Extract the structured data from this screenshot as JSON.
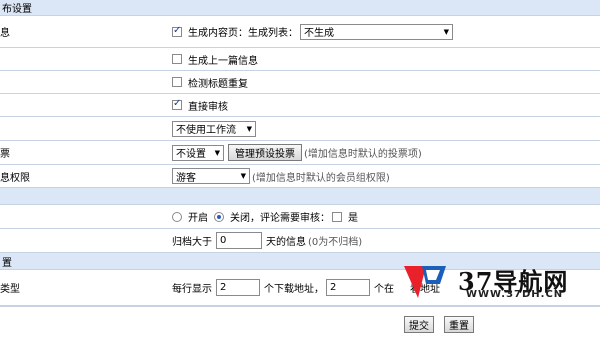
{
  "top": {
    "partial_text": "..."
  },
  "sections": {
    "publish": "布设置",
    "reply": "置"
  },
  "rows": {
    "r1_label": "息",
    "r1_checkbox": "生成内容页：",
    "r1_list_label": "生成列表：",
    "r1_list_value": "不生成",
    "r2_checkbox": "生成上一篇信息",
    "r3_checkbox": "检测标题重复",
    "r4_checkbox": "直接审核",
    "r5_label": "",
    "r5_select": "不使用工作流",
    "r6_label": "票",
    "r6_select": "不设置",
    "r6_button": "管理预设投票",
    "r6_note": "(增加信息时默认的投票项)",
    "r7_label": "息权限",
    "r7_select": "游客",
    "r7_note": "(增加信息时默认的会员组权限)",
    "r9_open": "开启",
    "r9_close": "关闭，评论需要审核：",
    "r9_yes": "是",
    "r10_prefix": "归档大于",
    "r10_value": "0",
    "r10_suffix": "天的信息",
    "r10_note": "(0为不归档)",
    "r12_label": "类型",
    "r12_prefix": "每行显示",
    "r12_value1": "2",
    "r12_mid": "个下载地址，",
    "r12_value2": "2",
    "r12_suffix": "个在",
    "r12_suffix_rest": "看地址"
  },
  "buttons": {
    "submit": "提交",
    "reset": "重置"
  },
  "watermark": {
    "brand": "37导航网",
    "url": "WWW.37DH.CN",
    "colors": {
      "red": "#e8212a",
      "blue": "#1c5fb8"
    }
  }
}
